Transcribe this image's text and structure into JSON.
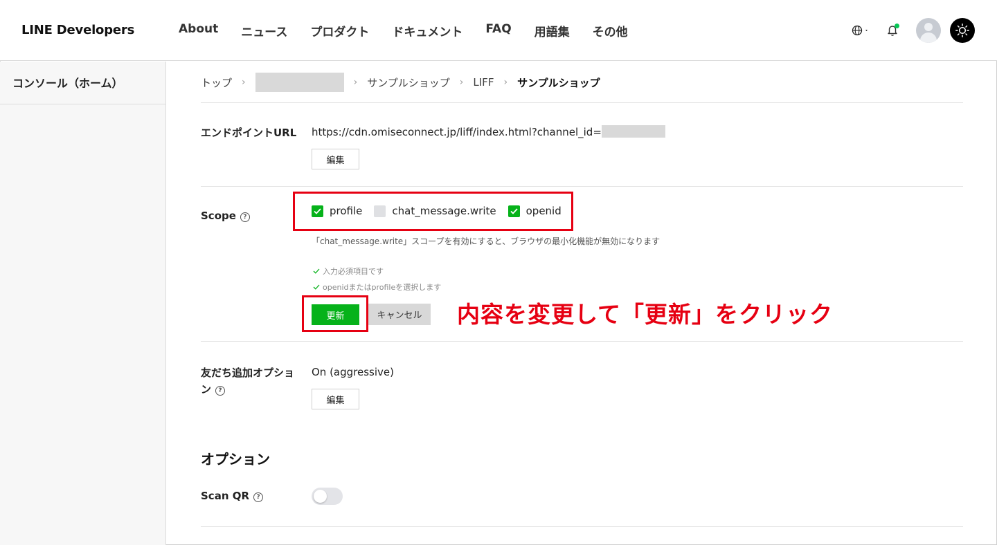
{
  "header": {
    "logo": "LINE Developers",
    "nav": [
      "About",
      "ニュース",
      "プロダクト",
      "ドキュメント",
      "FAQ",
      "用語集",
      "その他"
    ],
    "icons": [
      "globe-icon",
      "bell-icon",
      "avatar",
      "sun-icon"
    ],
    "notification_dot_color": "#06c755"
  },
  "sidebar": {
    "items": [
      {
        "label": "コンソール（ホーム）"
      }
    ]
  },
  "breadcrumb": {
    "items": [
      "トップ",
      "サンプルショップ",
      "LIFF"
    ],
    "current": "サンプルショップ"
  },
  "endpoint": {
    "label": "エンドポイントURL",
    "url": "https://cdn.omiseconnect.jp/liff/index.html?channel_id=",
    "edit_label": "編集"
  },
  "scope": {
    "label": "Scope",
    "options": [
      {
        "label": "profile",
        "checked": true
      },
      {
        "label": "chat_message.write",
        "checked": false
      },
      {
        "label": "openid",
        "checked": true
      }
    ],
    "note": "「chat_message.write」スコープを有効にすると、ブラウザの最小化機能が無効になります",
    "validations": [
      "入力必須項目です",
      "openidまたはprofileを選択します"
    ],
    "update_label": "更新",
    "cancel_label": "キャンセル"
  },
  "annotation": {
    "text": "内容を変更して「更新」をクリック",
    "color": "#e60012"
  },
  "friend_option": {
    "label_line1": "友だち追加オプショ",
    "label_line2": "ン",
    "value": "On (aggressive)",
    "edit_label": "編集"
  },
  "options_section": {
    "title": "オプション",
    "scan_qr": {
      "label": "Scan QR",
      "enabled": false
    }
  },
  "colors": {
    "accent_green": "#06b21a",
    "highlight_red": "#e60012"
  }
}
